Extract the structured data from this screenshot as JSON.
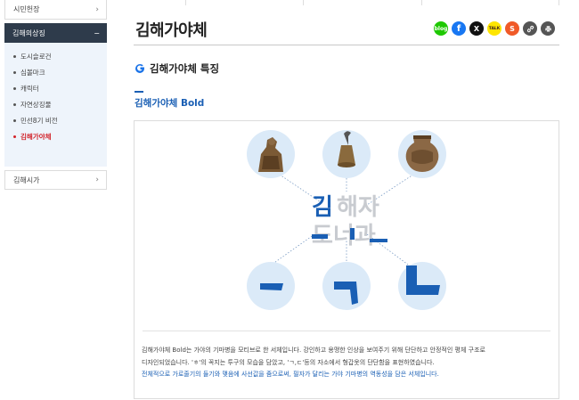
{
  "sidebar": {
    "top_item": "시민헌장",
    "active_item": "김해의상징",
    "active_toggle": "−",
    "sub_items": [
      "도시슬로건",
      "심볼마크",
      "캐릭터",
      "자연상징물",
      "민선8기 비전",
      "김해가야체"
    ],
    "bottom_item": "김해시가",
    "chevron": "›"
  },
  "page": {
    "title": "김해가야체"
  },
  "share": [
    {
      "name": "blog-icon",
      "label": "blog",
      "color": "#1ec800"
    },
    {
      "name": "facebook-icon",
      "label": "f",
      "color": "#1877f2"
    },
    {
      "name": "x-icon",
      "label": "X",
      "color": "#111111"
    },
    {
      "name": "kakaotalk-icon",
      "label": "TALK",
      "color": "#fee500"
    },
    {
      "name": "kakaostory-icon",
      "label": "S",
      "color": "#f05a28"
    },
    {
      "name": "link-icon",
      "label": "🔗",
      "color": "#555555"
    },
    {
      "name": "print-icon",
      "label": "🖶",
      "color": "#555555"
    }
  ],
  "section": {
    "heading": "김해가야체 특징",
    "subheading": "김해가야체 Bold"
  },
  "diagram": {
    "center_text_row1": "김해자",
    "center_text_row2": "도너과",
    "top_artifacts": [
      "warrior-figure",
      "bell",
      "pottery"
    ],
    "stroke_shapes": [
      "horizontal-stroke",
      "giyeok-stroke",
      "digeut-stroke"
    ]
  },
  "description": {
    "line1": "김해가야체 Bold는 가야의 기마병을 모티브로 한 서체입니다. 강인하고 용맹한 인상을 보여주기 위해 단단하고 안정적인 평체 구조로",
    "line2": "디자인되었습니다. 'ㅎ'의 꼭지는 투구의 모습을 담았고, 'ㄱ,ㄷ'등의 자소에서 형갑옷의 단단함을 표현하였습니다.",
    "line3": "전체적으로 가로줄기의 들기와 맺음에 사선값을 줌으로써, 필자가 달리는 가야 기마병의 역동성을 담은 서체입니다."
  },
  "colors": {
    "accent_blue": "#1a5fb4",
    "sidebar_dark": "#2e3b4b",
    "current_red": "#d2232a"
  }
}
